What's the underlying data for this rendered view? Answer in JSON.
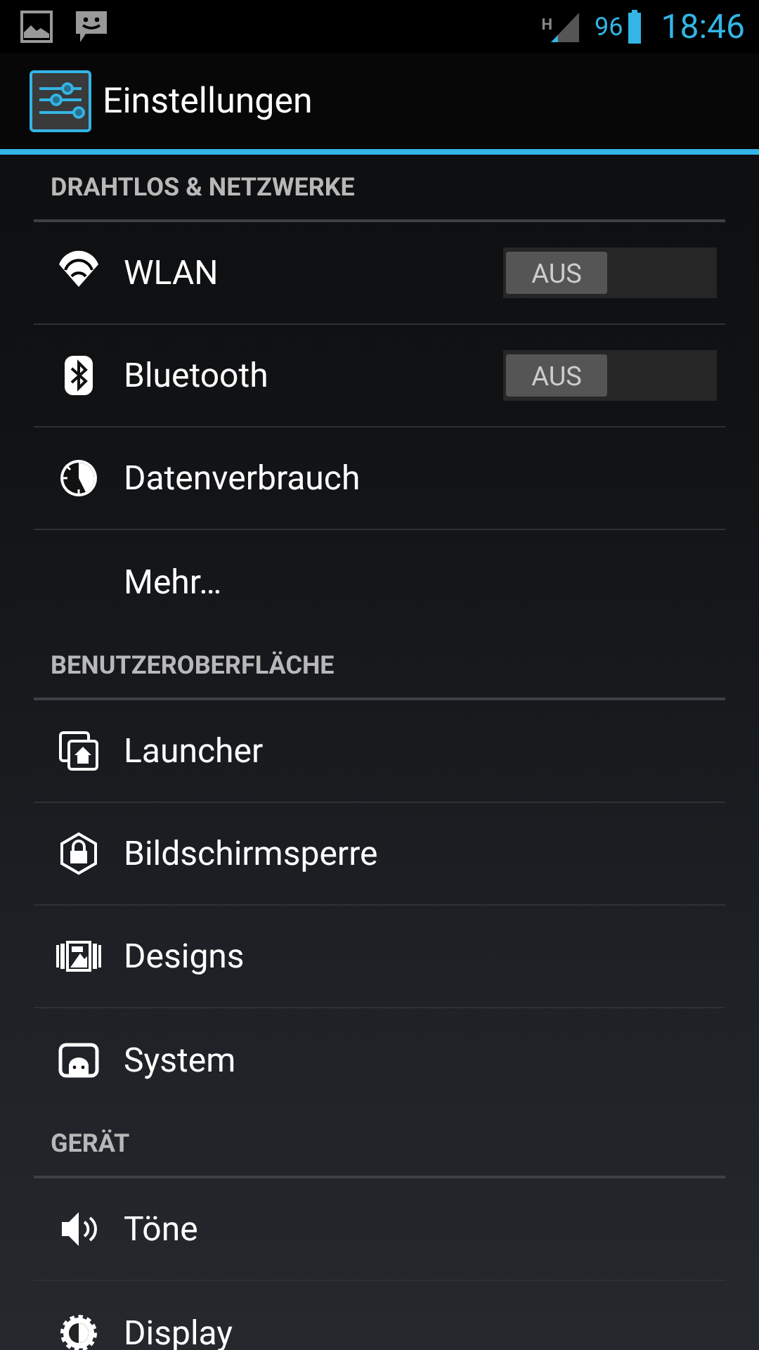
{
  "status_bar": {
    "network": "H",
    "battery": "96",
    "time": "18:46"
  },
  "action_bar": {
    "title": "Einstellungen"
  },
  "sections": [
    {
      "title": "DRAHTLOS & NETZWERKE",
      "items": [
        {
          "kind": "wifi",
          "label": "WLAN",
          "switch": {
            "on": false,
            "label": "AUS"
          }
        },
        {
          "kind": "bluetooth",
          "label": "Bluetooth",
          "switch": {
            "on": false,
            "label": "AUS"
          }
        },
        {
          "kind": "data",
          "label": "Datenverbrauch"
        },
        {
          "kind": "none",
          "label": "Mehr…"
        }
      ]
    },
    {
      "title": "BENUTZEROBERFLÄCHE",
      "items": [
        {
          "kind": "launcher",
          "label": "Launcher"
        },
        {
          "kind": "lock",
          "label": "Bildschirmsperre"
        },
        {
          "kind": "designs",
          "label": "Designs"
        },
        {
          "kind": "system",
          "label": "System"
        }
      ]
    },
    {
      "title": "GERÄT",
      "items": [
        {
          "kind": "sound",
          "label": "Töne"
        },
        {
          "kind": "display",
          "label": "Display"
        }
      ]
    }
  ]
}
